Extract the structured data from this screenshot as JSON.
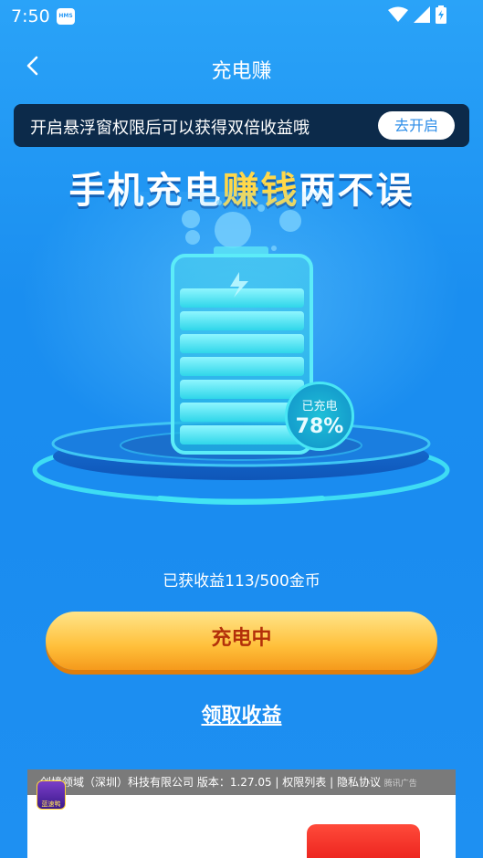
{
  "status_bar": {
    "time": "7:50",
    "badge": "HMS",
    "icons": [
      "wifi-icon",
      "signal-icon",
      "battery-charging-icon"
    ]
  },
  "nav": {
    "back_icon": "back-arrow-icon",
    "title": "充电赚"
  },
  "notice": {
    "text": "开启悬浮窗权限后可以获得双倍收益哦",
    "button": "去开启"
  },
  "hero": {
    "slogan_part1": "手机充电",
    "slogan_highlight": "赚钱",
    "slogan_part2": "两不误",
    "charge_label": "已充电",
    "charge_value": "78%",
    "charge_level": 0.78
  },
  "earnings": {
    "text": "已获收益113/500金币"
  },
  "actions": {
    "charging_button": "充电中",
    "claim_link": "领取收益"
  },
  "ad": {
    "header_text": "创境领域（深圳）科技有限公司  版本：1.27.05 | 权限列表  |  隐私协议",
    "source_tag": "腾讯广告",
    "app_icon_text": "蓝速鸭"
  },
  "colors": {
    "background": "#1a8ef0",
    "accent_yellow": "#ffd84a",
    "battery_cyan": "#42e4f4",
    "button_orange": "#ffbf3a",
    "button_text": "#b3300a"
  }
}
